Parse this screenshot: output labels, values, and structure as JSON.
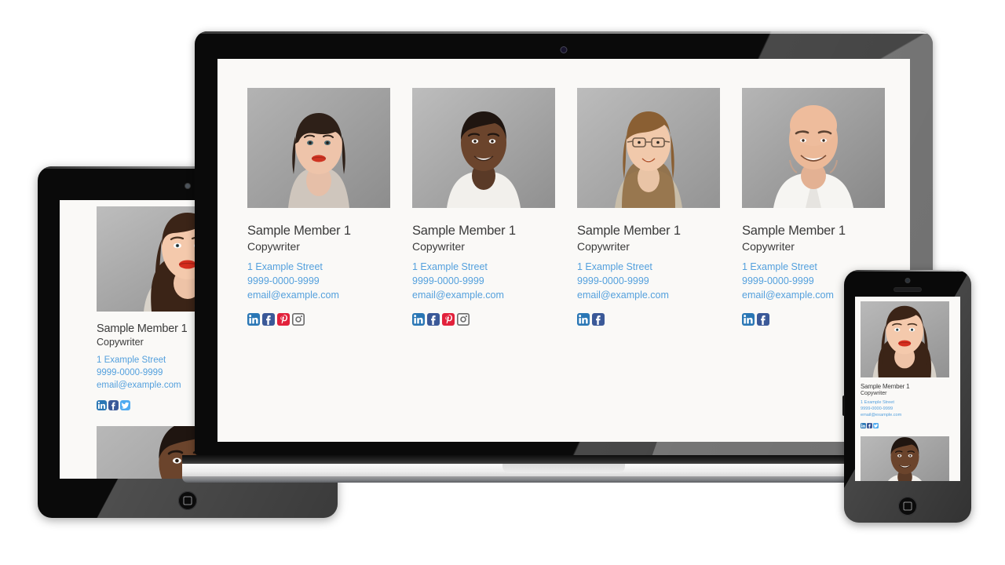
{
  "scene": {
    "devices": [
      "laptop",
      "tablet",
      "phone"
    ],
    "page_background": "#faf9f7",
    "link_color": "#54a0dd",
    "text_color": "#3a3a3a"
  },
  "member": {
    "name": "Sample Member 1",
    "role": "Copywriter",
    "address": "1 Example Street",
    "phone": "9999-0000-9999",
    "email": "email@example.com"
  },
  "laptop": {
    "cards": [
      {
        "name": "Sample Member 1",
        "role": "Copywriter",
        "address": "1 Example Street",
        "phone": "9999-0000-9999",
        "email": "email@example.com",
        "photo": "woman-dark-hair-portrait",
        "socials": [
          "linkedin-icon",
          "facebook-icon",
          "pinterest-icon",
          "instagram-icon"
        ]
      },
      {
        "name": "Sample Member 1",
        "role": "Copywriter",
        "address": "1 Example Street",
        "phone": "9999-0000-9999",
        "email": "email@example.com",
        "photo": "man-black-white-tshirt-portrait",
        "socials": [
          "linkedin-icon",
          "facebook-icon",
          "pinterest-icon",
          "instagram-icon"
        ]
      },
      {
        "name": "Sample Member 1",
        "role": "Copywriter",
        "address": "1 Example Street",
        "phone": "9999-0000-9999",
        "email": "email@example.com",
        "photo": "woman-glasses-portrait",
        "socials": [
          "linkedin-icon",
          "facebook-icon"
        ]
      },
      {
        "name": "Sample Member 1",
        "role": "Copywriter",
        "address": "1 Example Street",
        "phone": "9999-0000-9999",
        "email": "email@example.com",
        "photo": "bald-man-white-shirt-portrait",
        "socials": [
          "linkedin-icon",
          "facebook-icon"
        ]
      }
    ]
  },
  "tablet": {
    "cards": [
      {
        "name": "Sample Member 1",
        "role": "Copywriter",
        "address": "1 Example Street",
        "phone": "9999-0000-9999",
        "email": "email@example.com",
        "photo": "woman-long-brown-hair-red-lips-portrait",
        "socials": [
          "linkedin-icon",
          "facebook-icon",
          "twitter-icon"
        ]
      }
    ],
    "next_photo": "man-black-white-tshirt-portrait"
  },
  "phone": {
    "cards": [
      {
        "name": "Sample Member 1",
        "role": "Copywriter",
        "address": "1 Example Street",
        "phone": "9999-0000-9999",
        "email": "email@example.com",
        "photo": "woman-long-brown-hair-red-lips-portrait",
        "socials": [
          "linkedin-icon",
          "facebook-icon",
          "twitter-icon"
        ]
      }
    ],
    "next_photo": "man-black-white-tshirt-portrait"
  },
  "social_colors": {
    "linkedin": "#2a77b5",
    "facebook": "#3b5998",
    "pinterest": "#e2213b",
    "instagram": "#6b6b6b",
    "twitter": "#4eaaf0"
  }
}
